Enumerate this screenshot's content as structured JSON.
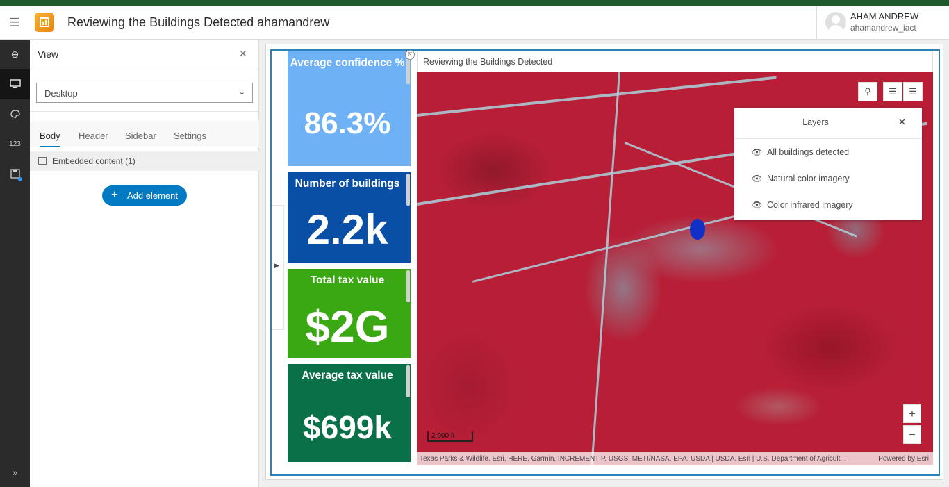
{
  "header": {
    "title": "Reviewing the Buildings Detected ahamandrew",
    "user_name": "AHAM ANDREW",
    "user_id": "ahamandrew_iact"
  },
  "rail": {
    "icons": [
      "add-icon",
      "desktop-icon",
      "theme-icon",
      "number-icon",
      "save-icon",
      "expand-icon"
    ]
  },
  "panel": {
    "title": "View",
    "device_select": "Desktop",
    "tabs": [
      "Body",
      "Header",
      "Sidebar",
      "Settings"
    ],
    "active_tab": "Body",
    "embedded_label": "Embedded content (1)",
    "add_button": "Add element"
  },
  "dashboard": {
    "cards": [
      {
        "title": "Average confidence %",
        "value": "86.3%",
        "color": "#6fb1f5"
      },
      {
        "title": "Number of buildings",
        "value": "2.2k",
        "color": "#0a4fa6"
      },
      {
        "title": "Total tax value",
        "value": "$2G",
        "color": "#3aa812"
      },
      {
        "title": "Average tax value",
        "value": "$699k",
        "color": "#0a7048"
      }
    ],
    "map": {
      "title": "Reviewing the Buildings Detected",
      "layers_title": "Layers",
      "layers": [
        "All buildings detected",
        "Natural color imagery",
        "Color infrared imagery"
      ],
      "scale": "2,000 ft",
      "attribution": "Texas Parks & Wildlife, Esri, HERE, Garmin, INCREMENT P, USGS, METI/NASA, EPA, USDA | USDA, Esri | U.S. Department of Agricult...",
      "powered_by": "Powered by Esri"
    }
  }
}
